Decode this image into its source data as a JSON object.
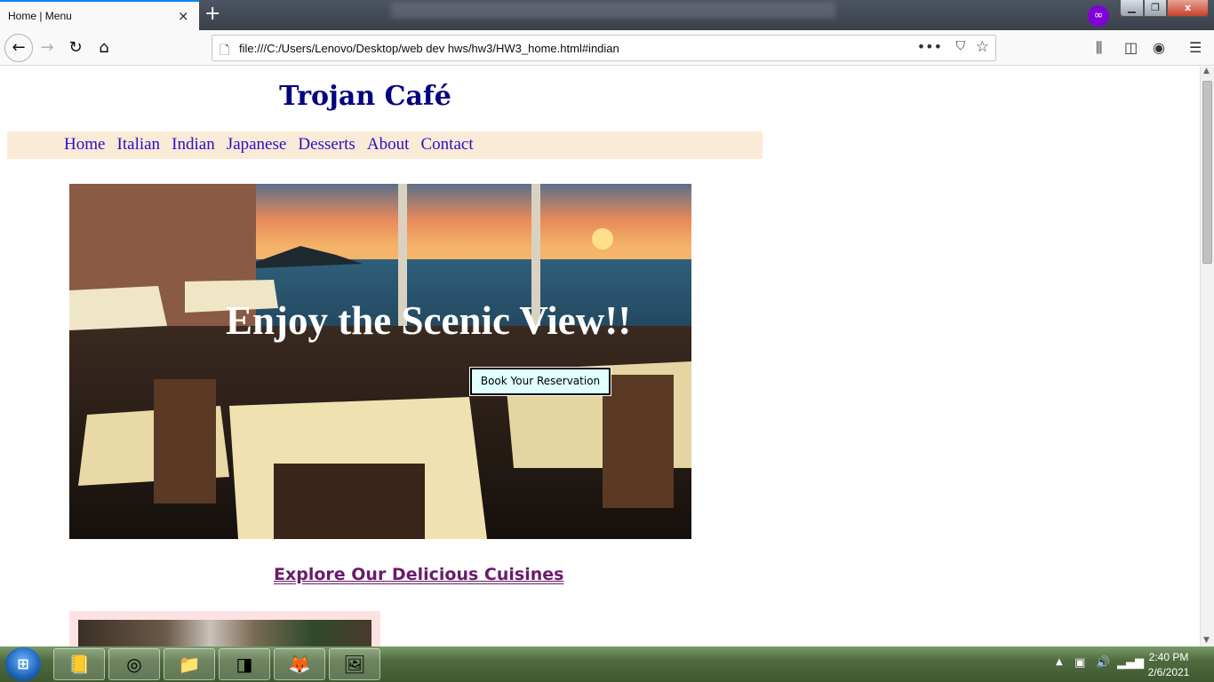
{
  "browser": {
    "tab_title": "Home | Menu",
    "tab_close_icon": "×",
    "new_tab_icon": "+",
    "private_icon": "∞",
    "window_min": "▁",
    "window_max": "❐",
    "window_close": "x",
    "url": "file:///C:/Users/Lenovo/Desktop/web dev hws/hw3/HW3_home.html#indian",
    "url_icon": "🗋",
    "page_actions_icon": "•••",
    "pocket_icon": "⛉",
    "bookmark_icon": "☆",
    "back_icon": "←",
    "forward_icon": "→",
    "reload_icon": "↻",
    "home_icon": "⌂",
    "library_icon": "⫼",
    "sidebar_icon": "◫",
    "account_icon": "◉",
    "menu_icon": "☰"
  },
  "site": {
    "title": "Trojan Café",
    "nav": [
      "Home",
      "Italian",
      "Indian",
      "Japanese",
      "Desserts",
      "About",
      "Contact"
    ],
    "hero_heading": "Enjoy the Scenic View!!",
    "book_button": "Book Your Reservation",
    "explore_heading": "Explore Our Delicious Cuisines"
  },
  "taskbar": {
    "start_icon": "⊞",
    "apps": [
      "📒",
      "◎",
      "📁",
      "◨",
      "🦊",
      "🖼"
    ],
    "tray_arrow": "▲",
    "tray_icons": [
      "▣",
      "🔊",
      "▂▄▆"
    ],
    "time": "2:40 PM",
    "date": "2/6/2021"
  },
  "colors": {
    "site_title": "#000080",
    "nav_bg": "#faebd7",
    "nav_link": "#2a0fc8",
    "explore_heading": "#6a1b6a",
    "book_button_bg": "#e0ffff"
  }
}
